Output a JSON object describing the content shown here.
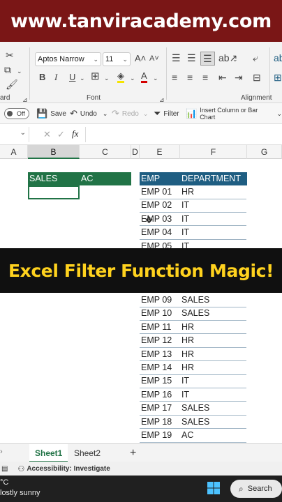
{
  "banner": {
    "text": "www.tanviracademy.com",
    "bg": "#7a1616"
  },
  "ribbon": {
    "font_name": "Aptos Narrow",
    "font_size": "11",
    "group_font": "Font",
    "group_alignment": "Alignment",
    "group_clipboard": "ard",
    "bold": "B",
    "italic": "I",
    "underline": "U"
  },
  "quick_toolbar": {
    "autosave": "Off",
    "save": "Save",
    "undo": "Undo",
    "redo": "Redo",
    "filter": "Filter",
    "insert_chart": "Insert Column or Bar Chart"
  },
  "formula_bar": {
    "fx": "fx"
  },
  "columns": [
    "A",
    "B",
    "C",
    "D",
    "E",
    "F",
    "G"
  ],
  "selected_column": "B",
  "criteria_table": {
    "headers": [
      "SALES",
      "AC"
    ],
    "color": "#217346"
  },
  "data_table": {
    "headers": [
      "EMP",
      "DEPARTMENT"
    ],
    "color": "#1f5e82",
    "rows_top": [
      [
        "EMP 01",
        "HR"
      ],
      [
        "EMP 02",
        "IT"
      ],
      [
        "EMP 03",
        "IT"
      ],
      [
        "EMP 04",
        "IT"
      ],
      [
        "EMP 05",
        "IT"
      ]
    ],
    "rows_bottom": [
      [
        "EMP 09",
        "SALES"
      ],
      [
        "EMP 10",
        "SALES"
      ],
      [
        "EMP 11",
        "HR"
      ],
      [
        "EMP 12",
        "HR"
      ],
      [
        "EMP 13",
        "HR"
      ],
      [
        "EMP 14",
        "HR"
      ],
      [
        "EMP 15",
        "IT"
      ],
      [
        "EMP 16",
        "IT"
      ],
      [
        "EMP 17",
        "SALES"
      ],
      [
        "EMP 18",
        "SALES"
      ],
      [
        "EMP 19",
        "AC"
      ]
    ]
  },
  "overlay": {
    "text": "Excel Filter Function Magic!",
    "color": "#ffd21e"
  },
  "sheets": {
    "tab1": "Sheet1",
    "tab2": "Sheet2",
    "add": "+"
  },
  "status": {
    "accessibility": "Accessibility: Investigate"
  },
  "taskbar": {
    "temp": "°C",
    "weather": "lostly sunny",
    "search": "Search"
  }
}
